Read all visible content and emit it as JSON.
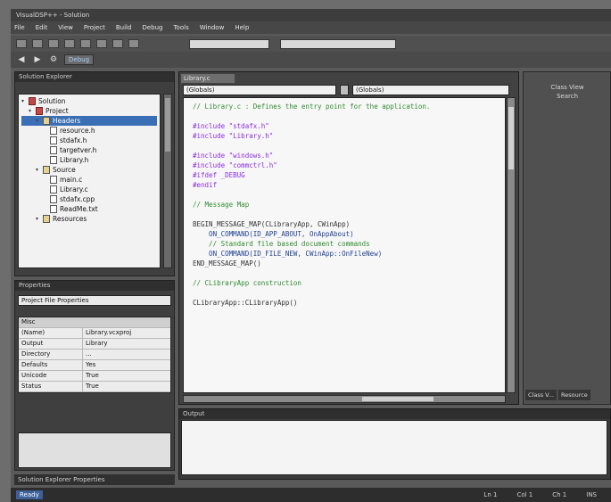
{
  "window": {
    "title": "VisualDSP++ - Solution"
  },
  "menu": [
    "File",
    "Edit",
    "View",
    "Project",
    "Build",
    "Debug",
    "Tools",
    "Window",
    "Help"
  ],
  "toolbar": {
    "config_combo": "Debug",
    "platform_combo": ""
  },
  "solution_explorer": {
    "title": "Solution Explorer",
    "items": [
      {
        "label": "Solution",
        "indent": 0,
        "type": "proj"
      },
      {
        "label": "Project",
        "indent": 1,
        "type": "proj"
      },
      {
        "label": "Headers",
        "indent": 2,
        "type": "folder",
        "selected": true
      },
      {
        "label": "resource.h",
        "indent": 3,
        "type": "file"
      },
      {
        "label": "stdafx.h",
        "indent": 3,
        "type": "file"
      },
      {
        "label": "targetver.h",
        "indent": 3,
        "type": "file"
      },
      {
        "label": "Library.h",
        "indent": 3,
        "type": "file"
      },
      {
        "label": "Source",
        "indent": 2,
        "type": "folder"
      },
      {
        "label": "main.c",
        "indent": 3,
        "type": "file"
      },
      {
        "label": "Library.c",
        "indent": 3,
        "type": "file"
      },
      {
        "label": "stdafx.cpp",
        "indent": 3,
        "type": "file"
      },
      {
        "label": "ReadMe.txt",
        "indent": 3,
        "type": "file"
      },
      {
        "label": "Resources",
        "indent": 2,
        "type": "folder"
      }
    ]
  },
  "properties": {
    "title": "Properties",
    "combo": "Project File Properties",
    "category": "Misc",
    "rows": [
      {
        "key": "(Name)",
        "value": "Library.vcxproj"
      },
      {
        "key": "Output",
        "value": "Library"
      },
      {
        "key": "Directory",
        "value": "..."
      },
      {
        "key": "Defaults",
        "value": "Yes"
      },
      {
        "key": "Unicode",
        "value": "True"
      },
      {
        "key": "Status",
        "value": "True"
      }
    ],
    "bottom_tab": "Solution Explorer Properties"
  },
  "editor": {
    "tab": "Library.c",
    "nav_left": "(Globals)",
    "nav_right": "(Globals)",
    "lines": [
      {
        "cls": "cm",
        "text": "// Library.c : Defines the entry point for the application."
      },
      {
        "cls": "st",
        "text": ""
      },
      {
        "cls": "kw",
        "text": "#include \"stdafx.h\""
      },
      {
        "cls": "kw",
        "text": "#include \"Library.h\""
      },
      {
        "cls": "st",
        "text": ""
      },
      {
        "cls": "kw",
        "text": "#include \"windows.h\""
      },
      {
        "cls": "kw",
        "text": "#include \"commctrl.h\""
      },
      {
        "cls": "kw",
        "text": "#ifdef _DEBUG"
      },
      {
        "cls": "kw",
        "text": "#endif"
      },
      {
        "cls": "st",
        "text": ""
      },
      {
        "cls": "cm",
        "text": "// Message Map"
      },
      {
        "cls": "st",
        "text": ""
      },
      {
        "cls": "st",
        "text": "BEGIN_MESSAGE_MAP(CLibraryApp, CWinApp)"
      },
      {
        "cls": "macro",
        "text": "    ON_COMMAND(ID_APP_ABOUT, OnAppAbout)"
      },
      {
        "cls": "cm",
        "text": "    // Standard file based document commands"
      },
      {
        "cls": "macro",
        "text": "    ON_COMMAND(ID_FILE_NEW, CWinApp::OnFileNew)"
      },
      {
        "cls": "st",
        "text": "END_MESSAGE_MAP()"
      },
      {
        "cls": "st",
        "text": ""
      },
      {
        "cls": "cm",
        "text": "// CLibraryApp construction"
      },
      {
        "cls": "st",
        "text": ""
      },
      {
        "cls": "st",
        "text": "CLibraryApp::CLibraryApp()"
      }
    ]
  },
  "right_panel": {
    "title": "Class View",
    "subtitle": "Search",
    "tabs": [
      "Class V...",
      "Resource"
    ]
  },
  "output": {
    "title": "Output"
  },
  "status": {
    "tab": "Ready",
    "ln": "Ln 1",
    "col": "Col 1",
    "ch": "Ch 1",
    "mode": "INS"
  }
}
